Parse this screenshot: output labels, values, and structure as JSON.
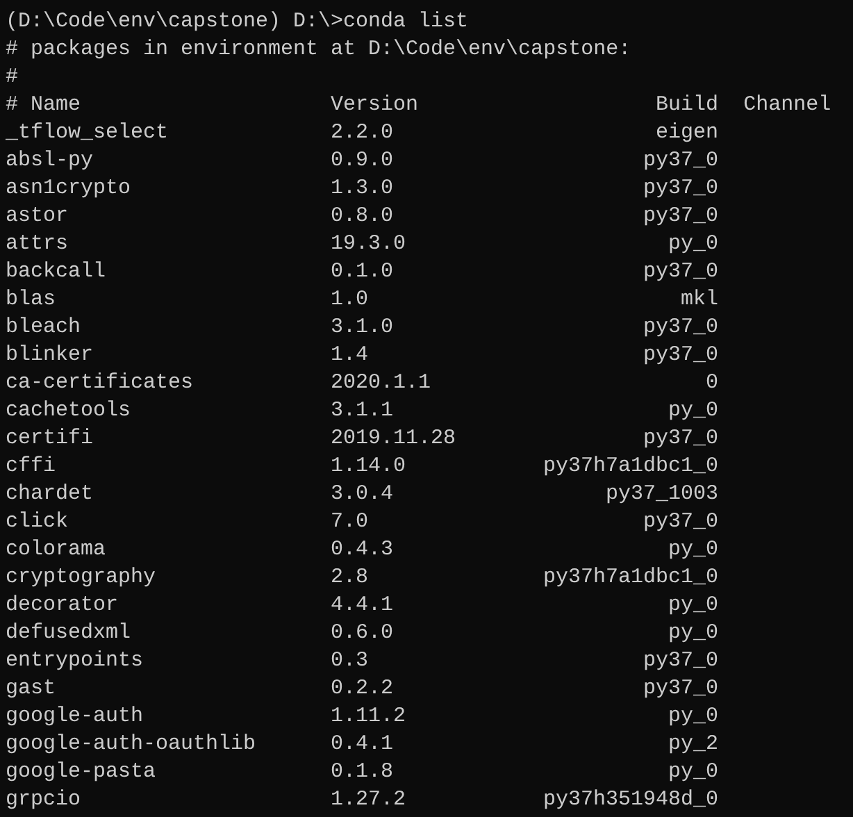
{
  "terminal": {
    "lines": [
      "(D:\\Code\\env\\capstone) D:\\>conda list",
      "# packages in environment at D:\\Code\\env\\capstone:",
      "#"
    ],
    "columns": [
      "# Name",
      "Version",
      "Build",
      "Channel"
    ],
    "rows": [
      {
        "name": "_tflow_select",
        "version": "2.2.0",
        "build": "eigen"
      },
      {
        "name": "absl-py",
        "version": "0.9.0",
        "build": "py37_0"
      },
      {
        "name": "asn1crypto",
        "version": "1.3.0",
        "build": "py37_0"
      },
      {
        "name": "astor",
        "version": "0.8.0",
        "build": "py37_0"
      },
      {
        "name": "attrs",
        "version": "19.3.0",
        "build": "py_0"
      },
      {
        "name": "backcall",
        "version": "0.1.0",
        "build": "py37_0"
      },
      {
        "name": "blas",
        "version": "1.0",
        "build": "mkl"
      },
      {
        "name": "bleach",
        "version": "3.1.0",
        "build": "py37_0"
      },
      {
        "name": "blinker",
        "version": "1.4",
        "build": "py37_0"
      },
      {
        "name": "ca-certificates",
        "version": "2020.1.1",
        "build": "0"
      },
      {
        "name": "cachetools",
        "version": "3.1.1",
        "build": "py_0"
      },
      {
        "name": "certifi",
        "version": "2019.11.28",
        "build": "py37_0"
      },
      {
        "name": "cffi",
        "version": "1.14.0",
        "build": "py37h7a1dbc1_0"
      },
      {
        "name": "chardet",
        "version": "3.0.4",
        "build": "py37_1003"
      },
      {
        "name": "click",
        "version": "7.0",
        "build": "py37_0"
      },
      {
        "name": "colorama",
        "version": "0.4.3",
        "build": "py_0"
      },
      {
        "name": "cryptography",
        "version": "2.8",
        "build": "py37h7a1dbc1_0"
      },
      {
        "name": "decorator",
        "version": "4.4.1",
        "build": "py_0"
      },
      {
        "name": "defusedxml",
        "version": "0.6.0",
        "build": "py_0"
      },
      {
        "name": "entrypoints",
        "version": "0.3",
        "build": "py37_0"
      },
      {
        "name": "gast",
        "version": "0.2.2",
        "build": "py37_0"
      },
      {
        "name": "google-auth",
        "version": "1.11.2",
        "build": "py_0"
      },
      {
        "name": "google-auth-oauthlib",
        "version": "0.4.1",
        "build": "py_2"
      },
      {
        "name": "google-pasta",
        "version": "0.1.8",
        "build": "py_0"
      },
      {
        "name": "grpcio",
        "version": "1.27.2",
        "build": "py37h351948d_0"
      }
    ]
  }
}
